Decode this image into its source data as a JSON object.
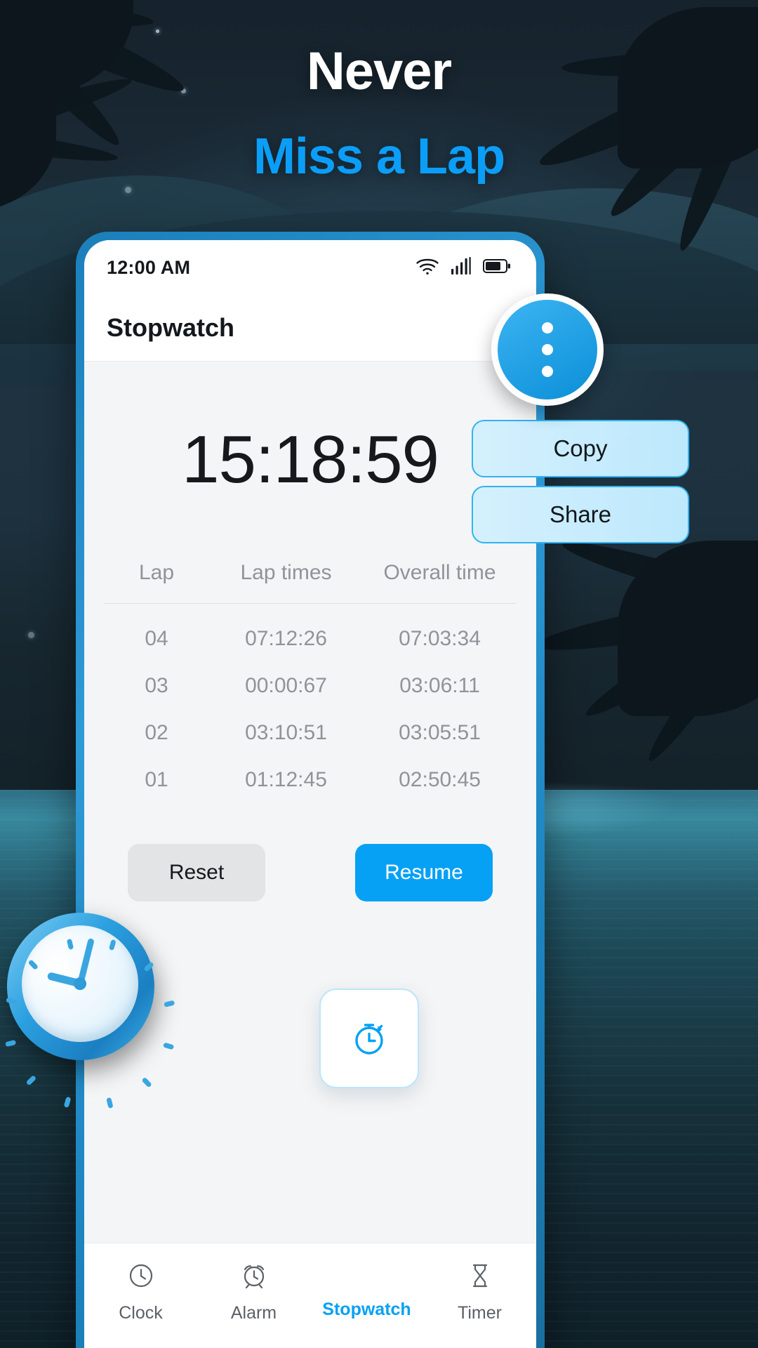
{
  "hero": {
    "line1": "Never",
    "line2": "Miss a Lap",
    "accent_color": "#0b9ef8",
    "line1_color": "#ffffff"
  },
  "phone": {
    "status_bar": {
      "time": "12:00 AM",
      "icons": [
        "wifi-icon",
        "cellular-signal-icon",
        "battery-icon"
      ]
    },
    "app_bar": {
      "title": "Stopwatch",
      "overflow_icon": "kebab-menu-icon"
    },
    "stopwatch": {
      "elapsed": "15:18:59",
      "table": {
        "headers": [
          "Lap",
          "Lap times",
          "Overall time"
        ],
        "rows": [
          {
            "lap": "04",
            "lap_time": "07:12:26",
            "overall_time": "07:03:34"
          },
          {
            "lap": "03",
            "lap_time": "00:00:67",
            "overall_time": "03:06:11"
          },
          {
            "lap": "02",
            "lap_time": "03:10:51",
            "overall_time": "03:05:51"
          },
          {
            "lap": "01",
            "lap_time": "01:12:45",
            "overall_time": "02:50:45"
          }
        ]
      },
      "actions": {
        "reset_label": "Reset",
        "resume_label": "Resume",
        "reset_color": "#e3e4e6",
        "resume_color": "#06a1f5"
      }
    },
    "overflow_menu": {
      "items": [
        {
          "label": "Copy"
        },
        {
          "label": "Share"
        }
      ],
      "fill_color": "#c7ecfd",
      "border_color": "#30b3f2"
    },
    "bottom_nav": {
      "items": [
        {
          "label": "Clock",
          "icon": "clock-icon",
          "active": false
        },
        {
          "label": "Alarm",
          "icon": "alarm-clock-icon",
          "active": false
        },
        {
          "label": "Stopwatch",
          "icon": "stopwatch-icon",
          "active": true
        },
        {
          "label": "Timer",
          "icon": "hourglass-icon",
          "active": false
        }
      ],
      "active_color": "#06a1f5",
      "inactive_color": "#5b6167"
    }
  },
  "decor": {
    "clock_illustration": "3d-clock-icon",
    "pointer": "kebab-menu-pin-cursor"
  }
}
